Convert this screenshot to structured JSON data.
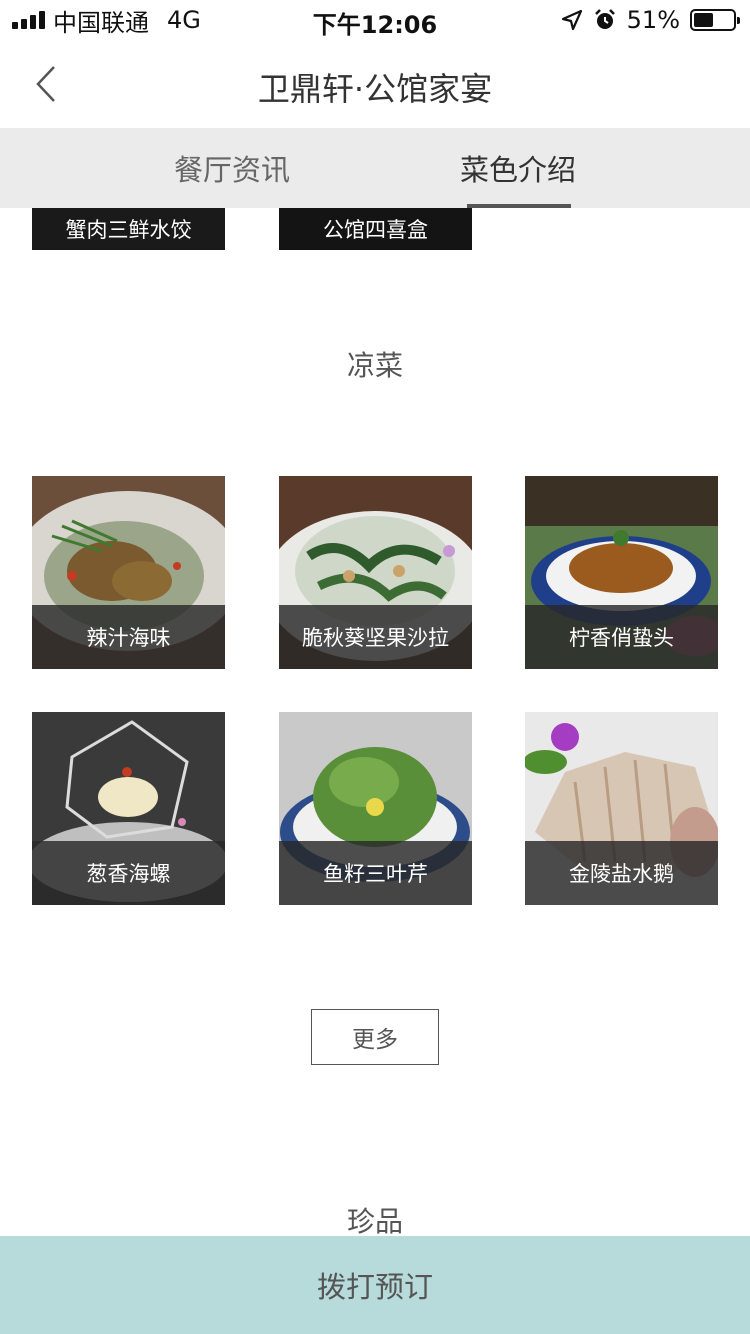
{
  "status_bar": {
    "carrier": "中国联通",
    "network": "4G",
    "time": "下午12:06",
    "battery_percent": "51%",
    "battery_level": 0.51,
    "icons": [
      "signal-icon",
      "location-arrow-icon",
      "alarm-icon",
      "battery-icon"
    ]
  },
  "nav": {
    "title": "卫鼎轩·公馆家宴",
    "back_icon": "chevron-left-icon"
  },
  "tabs": [
    {
      "label": "餐厅资讯",
      "active": false
    },
    {
      "label": "菜色介绍",
      "active": true
    }
  ],
  "partial_dishes": [
    {
      "name": "蟹肉三鲜水饺"
    },
    {
      "name": "公馆四喜盒"
    }
  ],
  "sections": [
    {
      "title": "凉菜",
      "dishes": [
        {
          "name": "辣汁海味"
        },
        {
          "name": "脆秋葵坚果沙拉"
        },
        {
          "name": "柠香俏蛰头"
        },
        {
          "name": "葱香海螺"
        },
        {
          "name": "鱼籽三叶芹"
        },
        {
          "name": "金陵盐水鹅"
        }
      ],
      "more_label": "更多"
    },
    {
      "title": "珍品"
    }
  ],
  "call_button": {
    "label": "拨打预订"
  },
  "colors": {
    "tab_bar_bg": "#ebebeb",
    "caption_overlay": "#282828",
    "call_bar_bg": "#b7dadb",
    "text_main": "#333333"
  }
}
